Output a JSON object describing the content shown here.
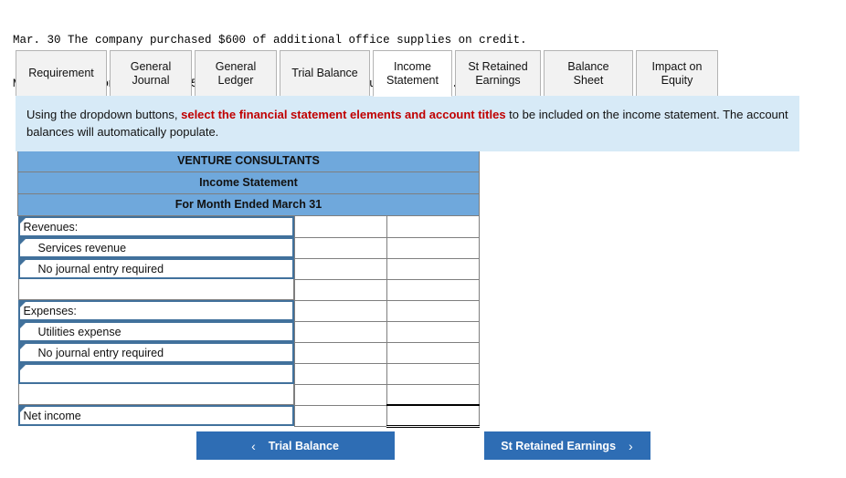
{
  "narrative": {
    "lines": [
      "Mar. 30 The company purchased $600 of additional office supplies on credit.",
      "Mar. 31 The company paid $500 cash for this month’s utility bill."
    ]
  },
  "tabs": [
    {
      "label": "Requirement",
      "active": false
    },
    {
      "label": "General\nJournal",
      "active": false
    },
    {
      "label": "General\nLedger",
      "active": false
    },
    {
      "label": "Trial Balance",
      "active": false
    },
    {
      "label": "Income\nStatement",
      "active": true
    },
    {
      "label": "St Retained\nEarnings",
      "active": false
    },
    {
      "label": "Balance Sheet",
      "active": false
    },
    {
      "label": "Impact on\nEquity",
      "active": false
    }
  ],
  "banner": {
    "text_before": "Using the dropdown buttons, ",
    "highlight": "select the financial statement elements and account titles",
    "text_after": " to be included on the income statement. The account balances will automatically populate.",
    "highlight_color": "#c00000",
    "background_color": "#d7eaf7"
  },
  "statement": {
    "header": {
      "company": "VENTURE CONSULTANTS",
      "title": "Income Statement",
      "period": "For Month Ended March 31",
      "background_color": "#6fa8dc"
    },
    "rows": [
      {
        "label": "Revenues:",
        "type": "dropdown",
        "indent": false,
        "amount1": "",
        "amount2": ""
      },
      {
        "label": "Services revenue",
        "type": "dropdown",
        "indent": true,
        "amount1": "",
        "amount2": ""
      },
      {
        "label": "No journal entry required",
        "type": "dropdown",
        "indent": true,
        "amount1": "",
        "amount2": ""
      },
      {
        "label": "",
        "type": "plain",
        "indent": false,
        "amount1": "",
        "amount2": ""
      },
      {
        "label": "Expenses:",
        "type": "dropdown",
        "indent": false,
        "amount1": "",
        "amount2": ""
      },
      {
        "label": "Utilities expense",
        "type": "dropdown",
        "indent": true,
        "amount1": "",
        "amount2": ""
      },
      {
        "label": "No journal entry required",
        "type": "dropdown",
        "indent": true,
        "amount1": "",
        "amount2": ""
      },
      {
        "label": "",
        "type": "dropdown",
        "indent": false,
        "amount1": "",
        "amount2": ""
      },
      {
        "label": "",
        "type": "plain",
        "indent": false,
        "amount1": "",
        "amount2": ""
      },
      {
        "label": "Net income",
        "type": "dropdown",
        "indent": false,
        "amount1": "",
        "amount2": "",
        "total": true
      }
    ]
  },
  "footer": {
    "prev": {
      "label": "Trial Balance",
      "icon": "chevron-left-icon",
      "glyph": "‹"
    },
    "next": {
      "label": "St Retained Earnings",
      "icon": "chevron-right-icon",
      "glyph": "›"
    },
    "button_color": "#2e6db4"
  }
}
